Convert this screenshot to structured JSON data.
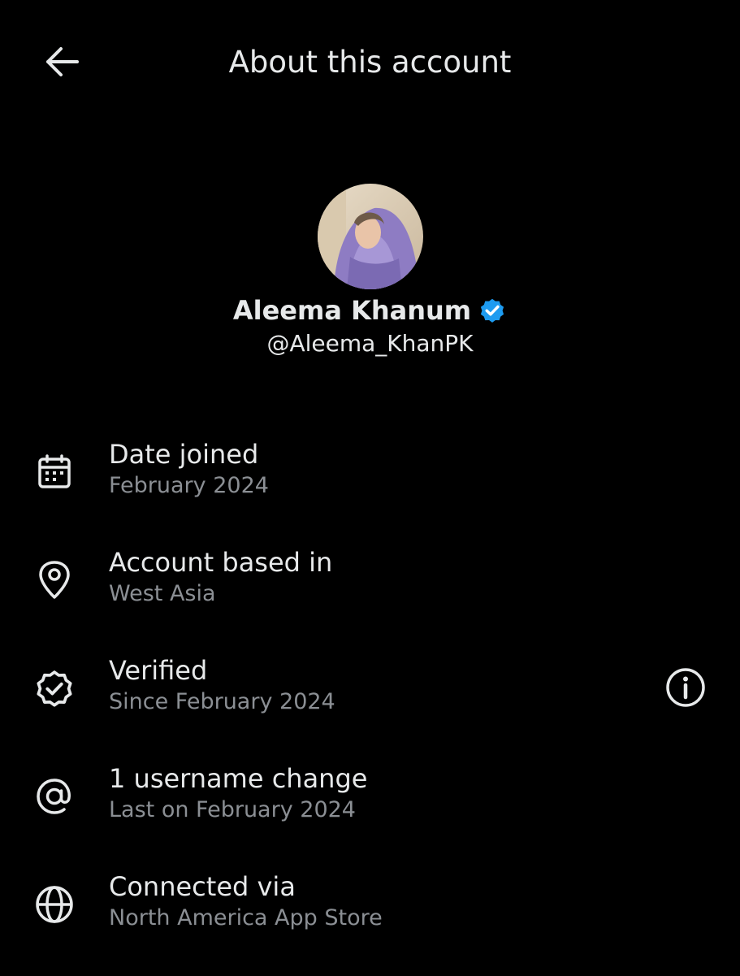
{
  "header": {
    "back_icon": "arrow-left-icon",
    "title": "About this account"
  },
  "profile": {
    "display_name": "Aleema Khanum",
    "handle": "@Aleema_KhanPK",
    "verified_badge_color": "#1d9bf0"
  },
  "details": [
    {
      "icon": "calendar-icon",
      "title": "Date joined",
      "value": "February 2024"
    },
    {
      "icon": "location-pin-icon",
      "title": "Account based in",
      "value": "West Asia"
    },
    {
      "icon": "verified-badge-icon",
      "title": "Verified",
      "value": "Since February 2024",
      "info_icon": "info-icon"
    },
    {
      "icon": "at-sign-icon",
      "title": "1 username change",
      "value": "Last on February 2024"
    },
    {
      "icon": "globe-icon",
      "title": "Connected via",
      "value": "North America App Store"
    }
  ],
  "colors": {
    "background": "#000000",
    "primary_text": "#e7e9ea",
    "secondary_text": "#8b8f94",
    "accent": "#1d9bf0"
  }
}
